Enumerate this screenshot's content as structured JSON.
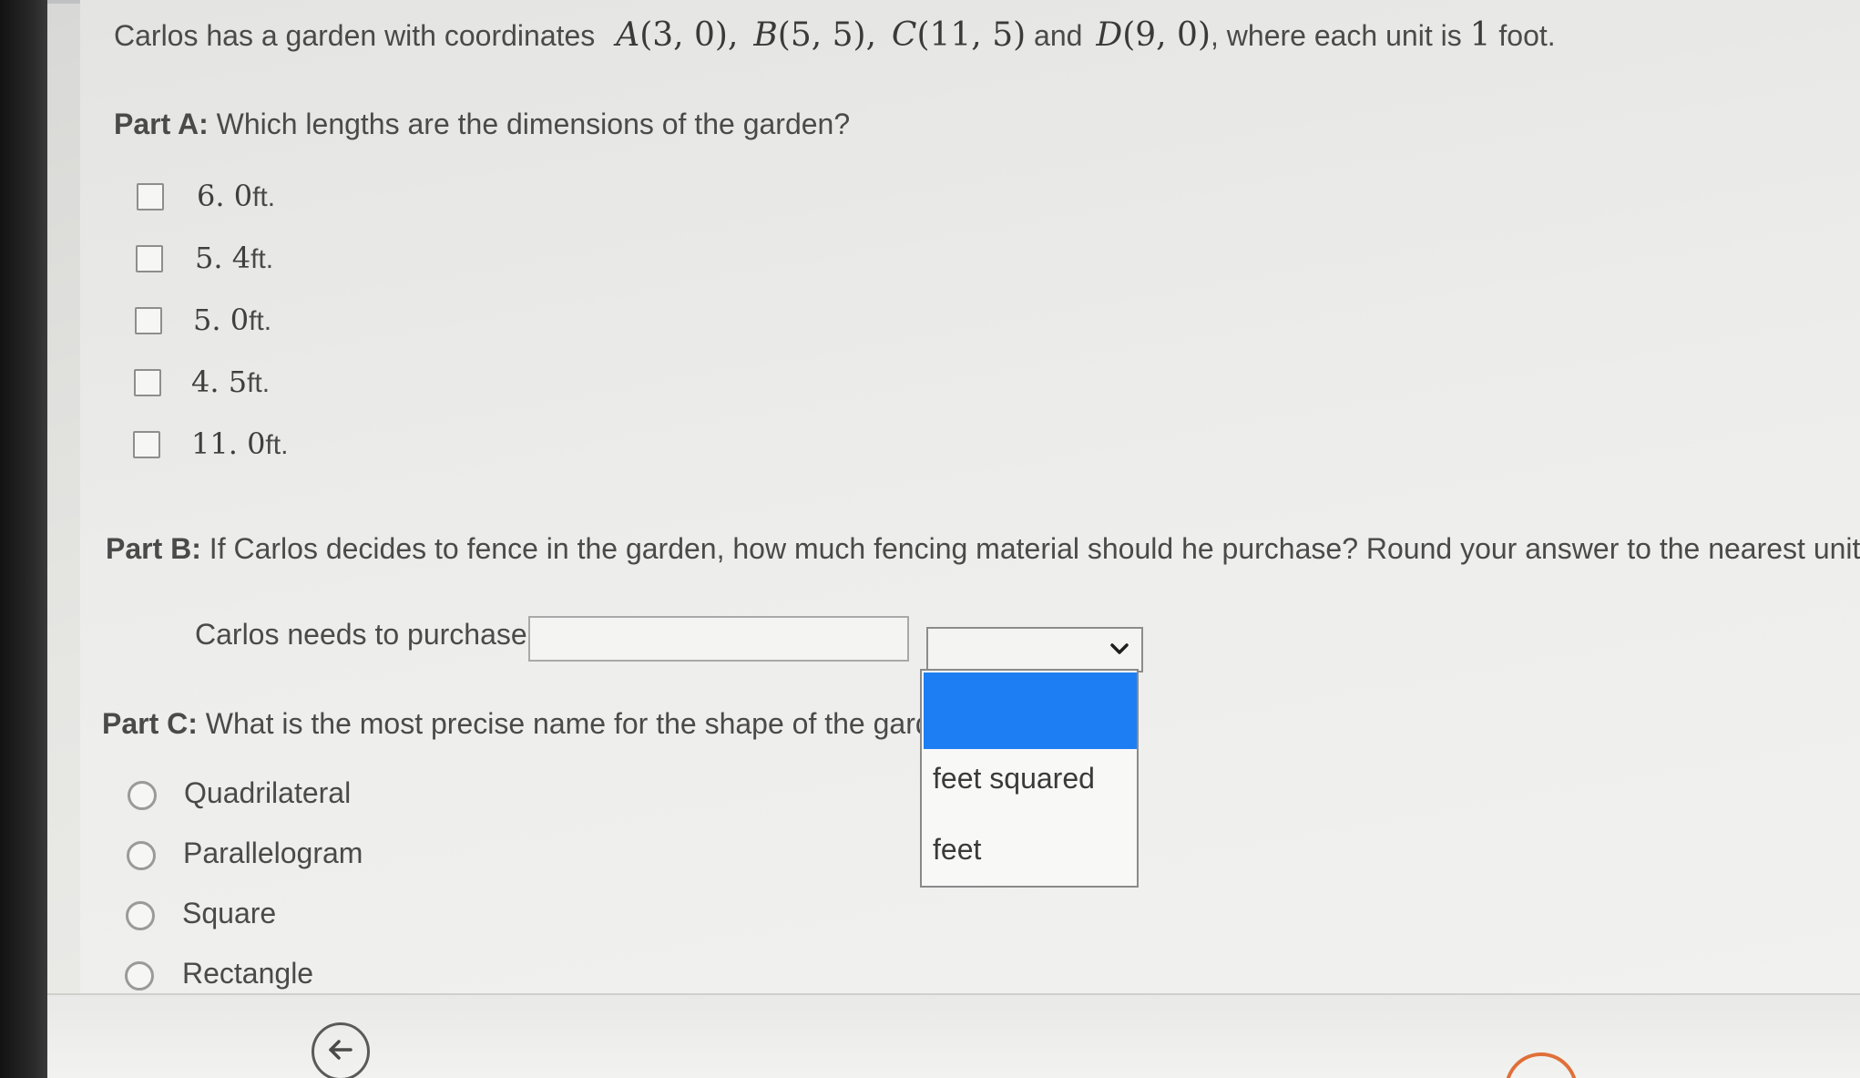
{
  "intro": {
    "prefix": "Carlos has a garden with coordinates",
    "points": [
      {
        "letter": "A",
        "coords": "(3, 0),"
      },
      {
        "letter": "B",
        "coords": "(5, 5),"
      },
      {
        "letter": "C",
        "coords": "(11, 5)"
      },
      {
        "letter": "D",
        "coords": "(9, 0)"
      }
    ],
    "and_word": "and",
    "suffix_start": ", where each unit is",
    "unit_number": "1",
    "suffix_end": "foot."
  },
  "part_a": {
    "label": "Part A:",
    "question": "Which lengths are the dimensions of the garden?",
    "options": [
      {
        "number": "6. 0",
        "unit": "ft."
      },
      {
        "number": "5. 4",
        "unit": "ft."
      },
      {
        "number": "5. 0",
        "unit": "ft."
      },
      {
        "number": "4. 5",
        "unit": "ft."
      },
      {
        "number": "11. 0",
        "unit": "ft."
      }
    ]
  },
  "part_b": {
    "label": "Part B:",
    "question": "If Carlos decides to fence in the garden, how much fencing material should he purchase? Round your answer to the nearest unit.",
    "prompt": "Carlos needs to purchase",
    "input_value": "",
    "unit_select": {
      "selected": "",
      "options": [
        "",
        "feet squared",
        "feet"
      ]
    }
  },
  "part_c": {
    "label": "Part C:",
    "question": "What is the most precise name for the shape of the garden",
    "options": [
      "Quadrilateral",
      "Parallelogram",
      "Square",
      "Rectangle"
    ]
  },
  "colors": {
    "dropdown_highlight": "#1c7ef2",
    "next_button_ring": "#e0703a"
  },
  "icons": {
    "back": "left-arrow-circle-icon",
    "dropdown": "chevron-down-icon"
  }
}
